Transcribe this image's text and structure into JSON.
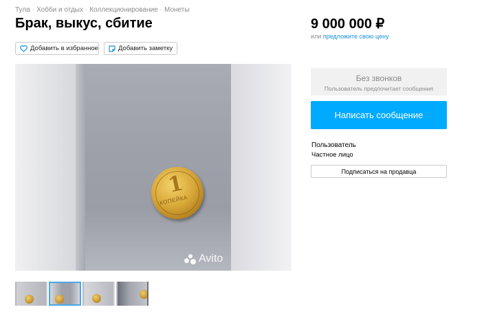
{
  "breadcrumb": [
    {
      "label": "Тула"
    },
    {
      "label": "Хобби и отдых"
    },
    {
      "label": "Коллекционирование"
    },
    {
      "label": "Монеты"
    }
  ],
  "breadcrumb_separator": "·",
  "listing": {
    "title": "Брак, выкус, сбитие",
    "favorite_label": "Добавить в избранное",
    "note_label": "Добавить заметку"
  },
  "gallery": {
    "watermark": "Avito",
    "coin_numeral": "1",
    "coin_word": "КОПЕЙКА",
    "thumbnail_count": 4,
    "active_thumbnail": 2
  },
  "sidebar": {
    "price": "9 000 000 ₽",
    "price_or": "или",
    "offer_price_link": "предложите свою цену",
    "no_calls_title": "Без звонков",
    "no_calls_subtitle": "Пользователь предпочитает сообщения",
    "message_button": "Написать сообщение",
    "seller_name": "Пользователь",
    "seller_type": "Частное лицо",
    "subscribe_button": "Подписаться на продавца"
  },
  "colors": {
    "accent": "#00aaff",
    "link": "#1a8fd6",
    "muted_text": "#8a8a8a",
    "active_thumb_border": "#48a7e8"
  }
}
